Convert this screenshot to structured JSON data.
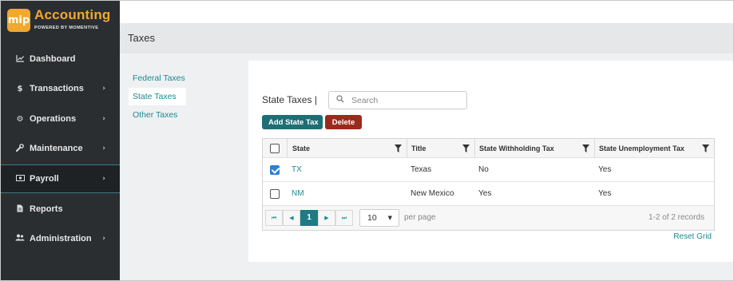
{
  "logo": {
    "badge": "mip",
    "title": "Accounting",
    "subtitle": "POWERED BY MOMENTIVE"
  },
  "sidebar": {
    "items": [
      {
        "label": "Dashboard",
        "icon": "chart-line-icon",
        "chevron": false
      },
      {
        "label": "Transactions",
        "icon": "dollar-icon",
        "chevron": true
      },
      {
        "label": "Operations",
        "icon": "gears-icon",
        "chevron": true
      },
      {
        "label": "Maintenance",
        "icon": "wrench-icon",
        "chevron": true
      },
      {
        "label": "Payroll",
        "icon": "money-bill-icon",
        "chevron": true,
        "active": true
      },
      {
        "label": "Reports",
        "icon": "document-icon",
        "chevron": false
      },
      {
        "label": "Administration",
        "icon": "users-icon",
        "chevron": true
      }
    ]
  },
  "page": {
    "title": "Taxes"
  },
  "subnav": {
    "items": [
      {
        "label": "Federal Taxes"
      },
      {
        "label": "State Taxes",
        "active": true
      },
      {
        "label": "Other Taxes"
      }
    ]
  },
  "section": {
    "title": "State Taxes |"
  },
  "search": {
    "placeholder": "Search",
    "value": ""
  },
  "actions": {
    "add_label": "Add State Tax",
    "delete_label": "Delete"
  },
  "grid": {
    "columns": [
      "State",
      "Title",
      "State Withholding Tax",
      "State Unemployment Tax"
    ],
    "rows": [
      {
        "checked": true,
        "state": "TX",
        "title": "Texas",
        "withholding": "No",
        "unemployment": "Yes"
      },
      {
        "checked": false,
        "state": "NM",
        "title": "New Mexico",
        "withholding": "Yes",
        "unemployment": "Yes"
      }
    ]
  },
  "pager": {
    "current_page": "1",
    "page_size": "10",
    "per_page_label": "per page",
    "count_label": "1-2 of 2 records"
  },
  "reset_label": "Reset Grid",
  "colors": {
    "teal": "#1e6e75",
    "link": "#1d8a92",
    "danger": "#9b2a1c",
    "sidebar": "#2b2e31",
    "logo": "#f0a830"
  }
}
